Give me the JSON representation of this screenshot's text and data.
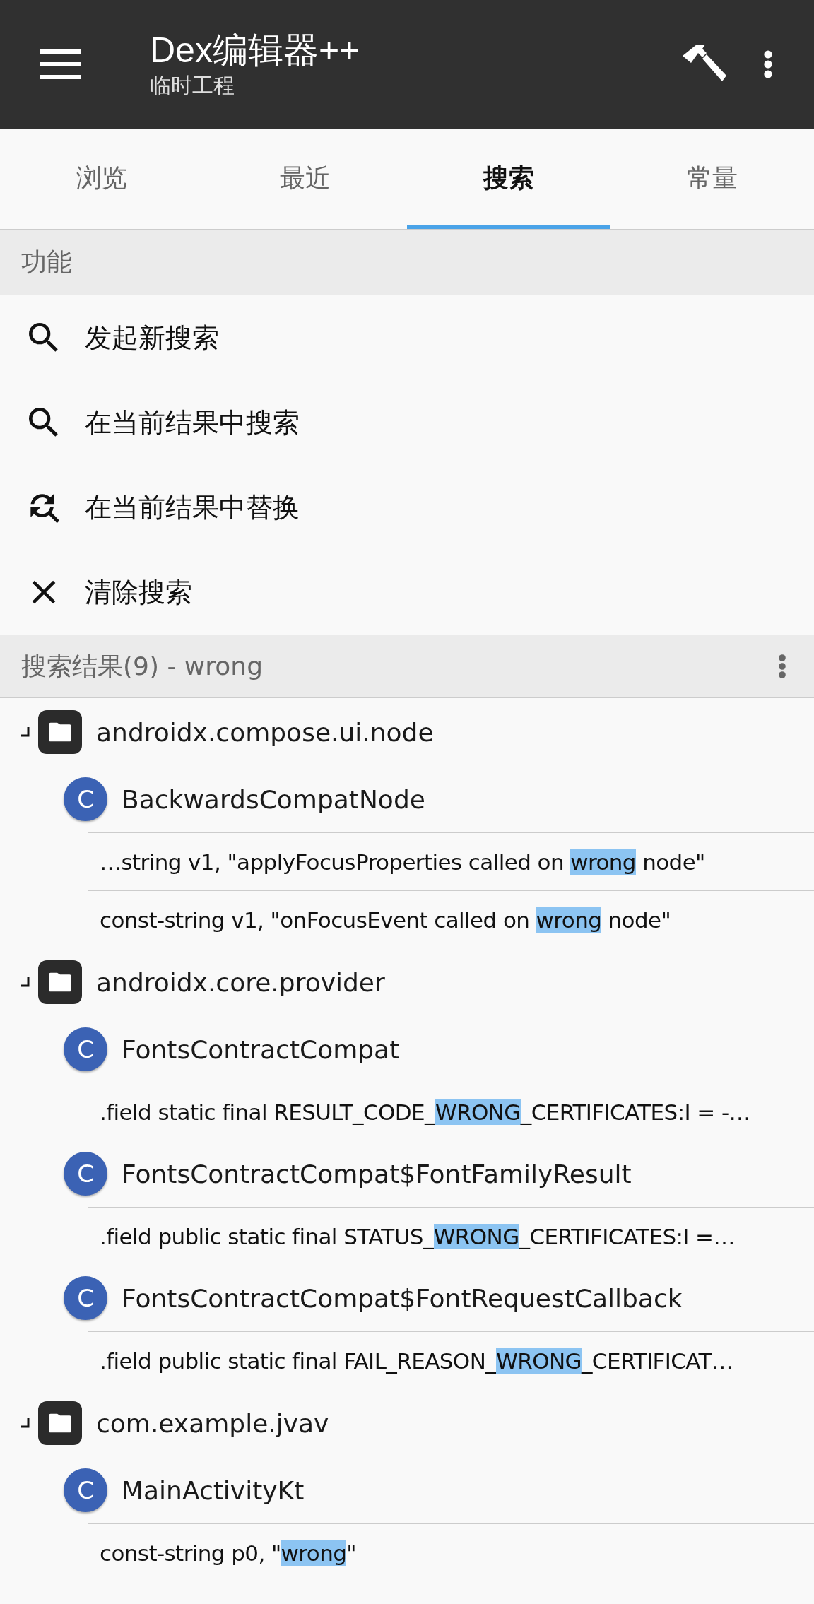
{
  "app_bar": {
    "title": "Dex编辑器++",
    "subtitle": "临时工程"
  },
  "tabs": [
    {
      "label": "浏览",
      "selected": false
    },
    {
      "label": "最近",
      "selected": false
    },
    {
      "label": "搜索",
      "selected": true
    },
    {
      "label": "常量",
      "selected": false
    }
  ],
  "functions": {
    "header": "功能",
    "items": [
      {
        "kind": "search",
        "label": "发起新搜索"
      },
      {
        "kind": "search",
        "label": "在当前结果中搜索"
      },
      {
        "kind": "replace",
        "label": "在当前结果中替换"
      },
      {
        "kind": "clear",
        "label": "清除搜索"
      }
    ]
  },
  "results": {
    "header": "搜索结果(9) - wrong",
    "tree": [
      {
        "label": "androidx.compose.ui.node",
        "expanded": true,
        "children": [
          {
            "badge": "C",
            "label": "BackwardsCompatNode",
            "children": [
              {
                "before": "…string v1, \"applyFocusProperties called on ",
                "match": "wrong",
                "after": " node\""
              },
              {
                "before": "const-string v1, \"onFocusEvent called on ",
                "match": "wrong",
                "after": " node\""
              }
            ]
          }
        ]
      },
      {
        "label": "androidx.core.provider",
        "expanded": true,
        "children": [
          {
            "badge": "C",
            "label": "FontsContractCompat",
            "children": [
              {
                "before": ".field static final RESULT_CODE_",
                "match": "WRONG",
                "after": "_CERTIFICATES:I = -…"
              }
            ]
          },
          {
            "badge": "C",
            "label": "FontsContractCompat$FontFamilyResult",
            "children": [
              {
                "before": ".field public static final STATUS_",
                "match": "WRONG",
                "after": "_CERTIFICATES:I =…"
              }
            ]
          },
          {
            "badge": "C",
            "label": "FontsContractCompat$FontRequestCallback",
            "children": [
              {
                "before": ".field public static final FAIL_REASON_",
                "match": "WRONG",
                "after": "_CERTIFICAT…"
              }
            ]
          }
        ]
      },
      {
        "label": "com.example.jvav",
        "expanded": true,
        "children": [
          {
            "badge": "C",
            "label": "MainActivityKt",
            "children": [
              {
                "before": "const-string p0, \"",
                "match": "wrong",
                "after": "\""
              }
            ]
          }
        ]
      }
    ]
  }
}
